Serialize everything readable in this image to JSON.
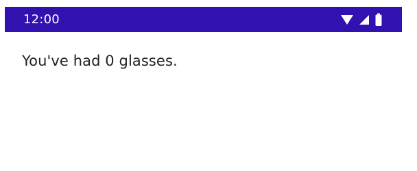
{
  "status_bar": {
    "time": "12:00",
    "icons": [
      "wifi-icon",
      "cellular-signal-icon",
      "battery-icon"
    ],
    "color": "#3111b0"
  },
  "main": {
    "message": "You've had 0 glasses."
  }
}
